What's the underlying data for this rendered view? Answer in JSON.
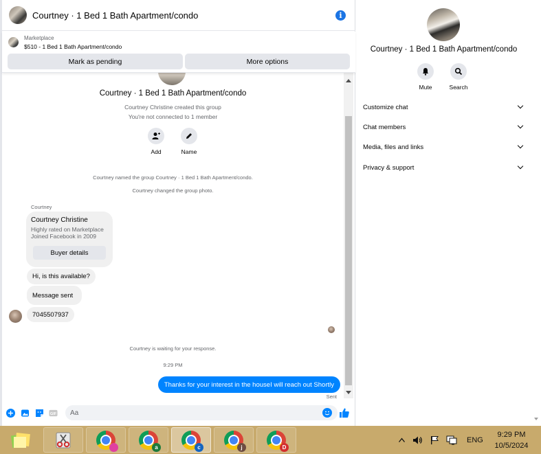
{
  "header": {
    "title": "Courtney · 1 Bed 1 Bath Apartment/condo",
    "info_icon": "i"
  },
  "marketplace": {
    "label": "Marketplace",
    "item": "$510 - 1 Bed 1 Bath Apartment/condo",
    "pending_button": "Mark as pending",
    "more_button": "More options"
  },
  "conversation": {
    "group_title": "Courtney · 1 Bed 1 Bath Apartment/condo",
    "created_text": "Courtney Christine created this group",
    "connection_text": "You're not connected to 1 member",
    "add_label": "Add",
    "name_label": "Name",
    "sys_named": "Courtney named the group Courtney · 1 Bed 1 Bath Apartment/condo.",
    "sys_photo": "Courtney changed the group photo.",
    "sender_name": "Courtney",
    "card": {
      "name": "Courtney Christine",
      "line1": "Highly rated on Marketplace",
      "line2": "Joined Facebook in 2009",
      "button": "Buyer details"
    },
    "msg_available": "Hi, is this available?",
    "msg_sent": "Message sent",
    "msg_phone": "7045507937",
    "waiting_text": "Courtney is waiting for your response.",
    "timestamp": "9:29 PM",
    "outgoing": "Thanks for your interest in the houseI will reach out Shortly",
    "sent_label": "Sent"
  },
  "composer": {
    "placeholder": "Aa"
  },
  "info_panel": {
    "title": "Courtney · 1 Bed 1 Bath Apartment/condo",
    "mute_label": "Mute",
    "search_label": "Search",
    "sections": [
      "Customize chat",
      "Chat members",
      "Media, files and links",
      "Privacy & support"
    ]
  },
  "taskbar": {
    "language": "ENG",
    "time": "9:29 PM",
    "date": "10/5/2024",
    "chrome_profiles": [
      "",
      "a",
      "c",
      "j",
      "D"
    ],
    "profile_colors": [
      "#e040a0",
      "#1e7a3c",
      "#1565c0",
      "#6d4c41",
      "#d32f2f"
    ]
  },
  "colors": {
    "accent": "#0084ff",
    "taskbar": "#c8aa6c"
  }
}
